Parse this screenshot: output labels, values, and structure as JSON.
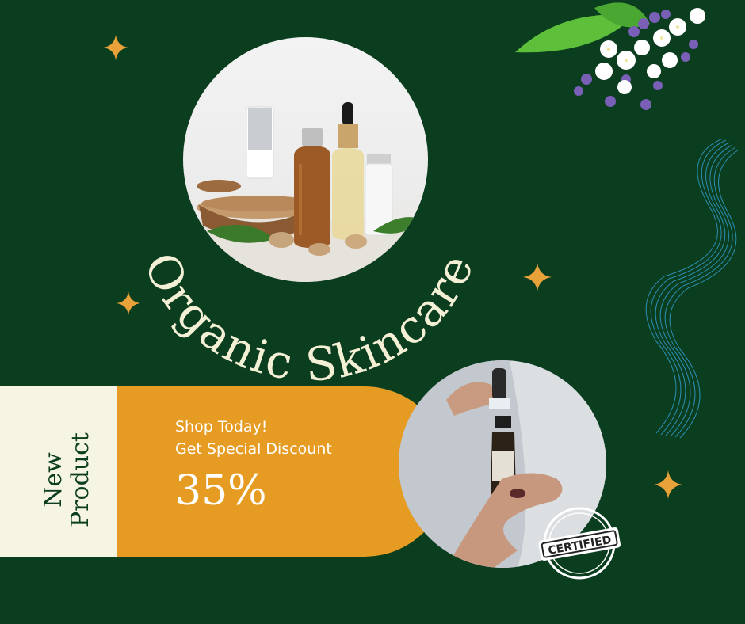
{
  "hero": {
    "title": "Organic Skincare"
  },
  "banner": {
    "badge_line1": "New",
    "badge_line2": "Product",
    "promo_line1": "Shop Today!",
    "promo_line2": "Get Special Discount",
    "discount": "35%"
  },
  "stamp": {
    "label": "CERTIFIED"
  },
  "icons": {
    "sparkle": "sparkle-icon",
    "flower": "flower-bouquet-icon",
    "wave": "wave-lines-icon"
  },
  "colors": {
    "background": "#0b3d1f",
    "accent_orange": "#e69b22",
    "cream": "#f6f5e4",
    "sparkle": "#e9a23a",
    "title": "#f4f0d6"
  }
}
